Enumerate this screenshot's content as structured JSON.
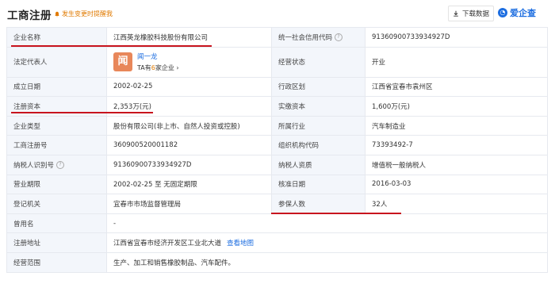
{
  "header": {
    "title": "工商注册",
    "notify_label": "发生变更时提醒我",
    "download_label": "下载数据",
    "brand_name": "爱企查"
  },
  "rows": {
    "r1": {
      "l1": "企业名称",
      "v1": "江西英龙橡胶科技股份有限公司",
      "l2": "统一社会信用代码",
      "v2": "91360900733934927D"
    },
    "r2": {
      "l1": "法定代表人",
      "avatar_char": "闻",
      "person_name": "闻一龙",
      "ta_prefix": "TA有",
      "ta_count": "6",
      "ta_suffix": "家企业",
      "l2": "经营状态",
      "v2": "开业"
    },
    "r3": {
      "l1": "成立日期",
      "v1": "2002-02-25",
      "l2": "行政区划",
      "v2": "江西省宜春市袁州区"
    },
    "r4": {
      "l1": "注册资本",
      "v1": "2,353万(元)",
      "l2": "实缴资本",
      "v2": "1,600万(元)"
    },
    "r5": {
      "l1": "企业类型",
      "v1": "股份有限公司(非上市、自然人投资或控股)",
      "l2": "所属行业",
      "v2": "汽车制造业"
    },
    "r6": {
      "l1": "工商注册号",
      "v1": "360900520001182",
      "l2": "组织机构代码",
      "v2": "73393492-7"
    },
    "r7": {
      "l1": "纳税人识别号",
      "v1": "91360900733934927D",
      "l2": "纳税人资质",
      "v2": "增值税一般纳税人"
    },
    "r8": {
      "l1": "营业期限",
      "v1": "2002-02-25 至 无固定期限",
      "l2": "核准日期",
      "v2": "2016-03-03"
    },
    "r9": {
      "l1": "登记机关",
      "v1": "宜春市市场监督管理局",
      "l2": "参保人数",
      "v2": "32人"
    },
    "r10": {
      "l1": "曾用名",
      "v1": "-"
    },
    "r11": {
      "l1": "注册地址",
      "v1": "江西省宜春市经济开发区工业北大道",
      "map_link": "查看地图"
    },
    "r12": {
      "l1": "经营范围",
      "v1": "生产、加工和销售橡胶制品、汽车配件。"
    }
  },
  "colors": {
    "label_bg": "#f3f6fb",
    "link": "#1c6de0",
    "accent_orange": "#e07a00",
    "underline_red": "#c8141e"
  },
  "icons": {
    "bell": "bell-icon",
    "download": "download-icon",
    "help": "help-icon",
    "chevron": "chevron-right-icon"
  }
}
